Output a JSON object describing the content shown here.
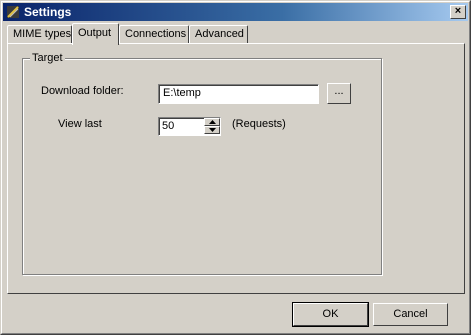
{
  "window": {
    "title": "Settings",
    "close_label": "×"
  },
  "tabs": [
    {
      "label": "MIME types",
      "active": false
    },
    {
      "label": "Output",
      "active": true
    },
    {
      "label": "Connections",
      "active": false
    },
    {
      "label": "Advanced",
      "active": false
    }
  ],
  "target_group": {
    "legend": "Target",
    "download_folder": {
      "label": "Download folder:",
      "value": "E:\\temp",
      "browse_label": "..."
    },
    "view_last": {
      "label": "View last",
      "value": "50",
      "unit": "(Requests)"
    }
  },
  "buttons": {
    "ok": "OK",
    "cancel": "Cancel"
  },
  "colors": {
    "titlebar_start": "#0a246a",
    "titlebar_end": "#a6caf0",
    "face": "#d4d0c8"
  }
}
